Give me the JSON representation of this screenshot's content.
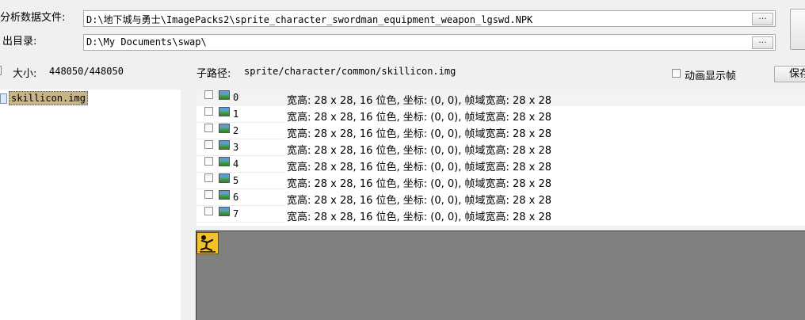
{
  "top": {
    "analyze_label": "分析数据文件:",
    "analyze_path": "D:\\地下城与勇士\\ImagePacks2\\sprite_character_swordman_equipment_weapon_lgswd.NPK",
    "output_label": "出目录:",
    "output_path": "D:\\My Documents\\swap\\",
    "browse_label": "..."
  },
  "status": {
    "size_label": "大小:",
    "size_value": "448050/448050",
    "subpath_label": "子路径:",
    "subpath_value": "sprite/character/common/skillicon.img",
    "animate_label": "动画显示帧",
    "save_label": "保存"
  },
  "tree": {
    "items": [
      {
        "name": "skillicon.img"
      }
    ]
  },
  "frames": {
    "rows": [
      {
        "index": "0",
        "info": "宽高: 28 x 28, 16 位色, 坐标: (0, 0), 帧域宽高: 28 x 28"
      },
      {
        "index": "1",
        "info": "宽高: 28 x 28, 16 位色, 坐标: (0, 0), 帧域宽高: 28 x 28"
      },
      {
        "index": "2",
        "info": "宽高: 28 x 28, 16 位色, 坐标: (0, 0), 帧域宽高: 28 x 28"
      },
      {
        "index": "3",
        "info": "宽高: 28 x 28, 16 位色, 坐标: (0, 0), 帧域宽高: 28 x 28"
      },
      {
        "index": "4",
        "info": "宽高: 28 x 28, 16 位色, 坐标: (0, 0), 帧域宽高: 28 x 28"
      },
      {
        "index": "5",
        "info": "宽高: 28 x 28, 16 位色, 坐标: (0, 0), 帧域宽高: 28 x 28"
      },
      {
        "index": "6",
        "info": "宽高: 28 x 28, 16 位色, 坐标: (0, 0), 帧域宽高: 28 x 28"
      },
      {
        "index": "7",
        "info": "宽高: 28 x 28, 16 位色, 坐标: (0, 0), 帧域宽高: 28 x 28"
      }
    ]
  },
  "colors": {
    "window_bg": "#f0f0f0",
    "preview_bg": "#808080",
    "selection": "#c8b489"
  }
}
